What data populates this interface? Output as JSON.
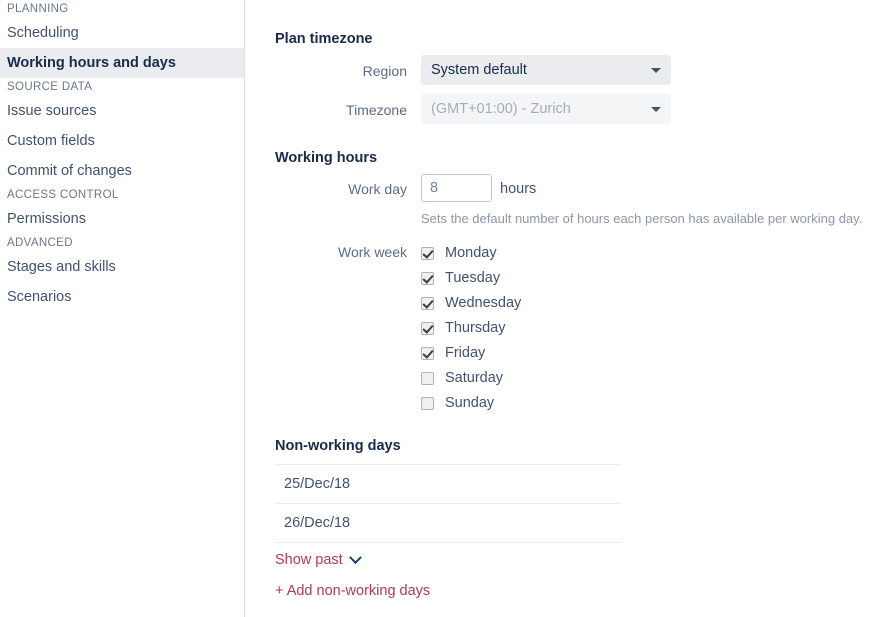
{
  "sidebar": {
    "groups": [
      {
        "header": "PLANNING",
        "items": [
          {
            "label": "Scheduling",
            "selected": false
          },
          {
            "label": "Working hours and days",
            "selected": true
          }
        ]
      },
      {
        "header": "SOURCE DATA",
        "items": [
          {
            "label": "Issue sources",
            "selected": false
          },
          {
            "label": "Custom fields",
            "selected": false
          },
          {
            "label": "Commit of changes",
            "selected": false
          }
        ]
      },
      {
        "header": "ACCESS CONTROL",
        "items": [
          {
            "label": "Permissions",
            "selected": false
          }
        ]
      },
      {
        "header": "ADVANCED",
        "items": [
          {
            "label": "Stages and skills",
            "selected": false
          },
          {
            "label": "Scenarios",
            "selected": false
          }
        ]
      }
    ]
  },
  "main": {
    "plan_timezone": {
      "title": "Plan timezone",
      "region_label": "Region",
      "region_value": "System default",
      "timezone_label": "Timezone",
      "timezone_value": "(GMT+01:00) - Zurich"
    },
    "working_hours": {
      "title": "Working hours",
      "work_day_label": "Work day",
      "work_day_value": "8",
      "work_day_placeholder": "8",
      "hours_unit": "hours",
      "help_text": "Sets the default number of hours each person has available per working day.",
      "work_week_label": "Work week",
      "days": [
        {
          "label": "Monday",
          "checked": true
        },
        {
          "label": "Tuesday",
          "checked": true
        },
        {
          "label": "Wednesday",
          "checked": true
        },
        {
          "label": "Thursday",
          "checked": true
        },
        {
          "label": "Friday",
          "checked": true
        },
        {
          "label": "Saturday",
          "checked": false
        },
        {
          "label": "Sunday",
          "checked": false
        }
      ]
    },
    "non_working_days": {
      "title": "Non-working days",
      "rows": [
        "25/Dec/18",
        "26/Dec/18"
      ],
      "show_past_label": "Show past",
      "add_label": "+ Add non-working days"
    }
  },
  "colors": {
    "link": "#b33a54",
    "heading": "#172b4d",
    "label": "#5e6c84",
    "selected_bg": "#ebecf0"
  }
}
